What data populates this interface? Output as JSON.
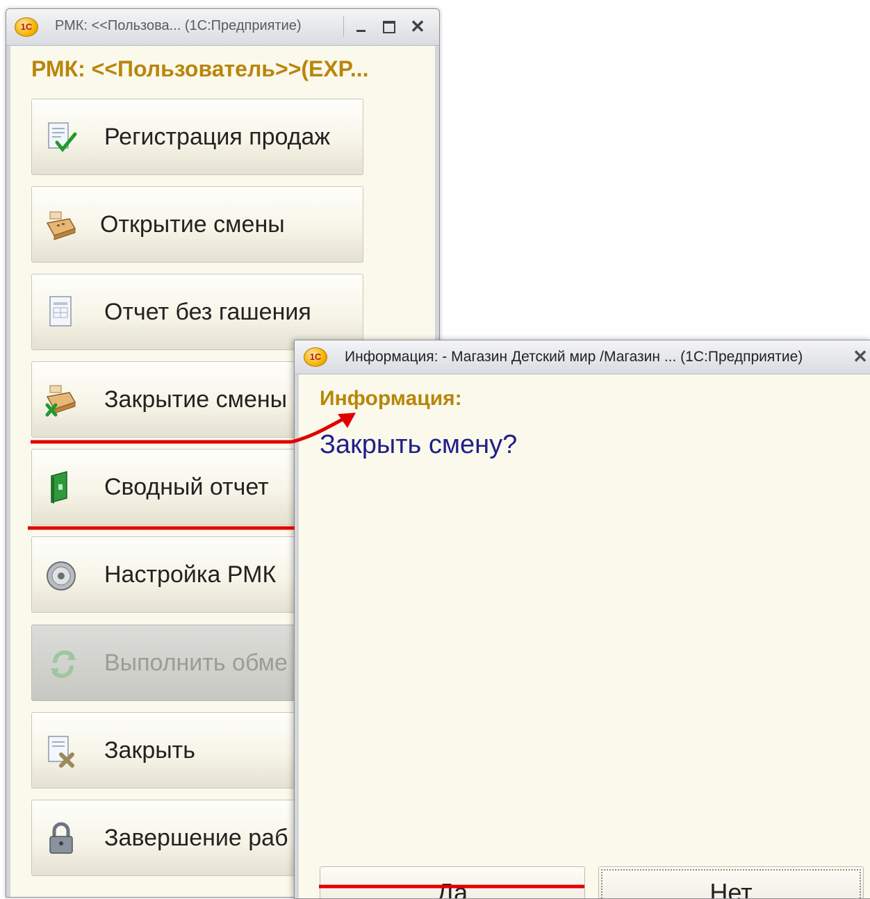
{
  "main_window": {
    "title": "РМК: <<Пользова... (1С:Предприятие)",
    "heading": "РМК: <<Пользователь>>(EXP...",
    "buttons": [
      {
        "label": "Регистрация продаж",
        "icon": "document-check-icon"
      },
      {
        "label": "Открытие смены",
        "icon": "cash-register-icon"
      },
      {
        "label": "Отчет без гашения",
        "icon": "report-document-icon"
      },
      {
        "label": "Закрытие смены",
        "icon": "cash-register-close-icon"
      },
      {
        "label": "Сводный отчет",
        "icon": "green-book-icon"
      },
      {
        "label": "Настройка РМК",
        "icon": "settings-disc-icon"
      },
      {
        "label": "Выполнить обме",
        "icon": "sync-arrows-icon",
        "disabled": true
      },
      {
        "label": "Закрыть",
        "icon": "document-close-icon"
      },
      {
        "label": "Завершение раб",
        "icon": "padlock-icon"
      }
    ]
  },
  "logo_text": "1С",
  "info_dialog": {
    "title": "Информация: - Магазин Детский мир /Магазин ... (1С:Предприятие)",
    "heading": "Информация:",
    "question": "Закрыть смену?",
    "yes_label": "Да",
    "no_label": "Нет"
  },
  "colors": {
    "heading": "#b8860b",
    "question": "#1f1f8a",
    "annotation": "#e00000",
    "panel_bg": "#fbf9ec"
  }
}
